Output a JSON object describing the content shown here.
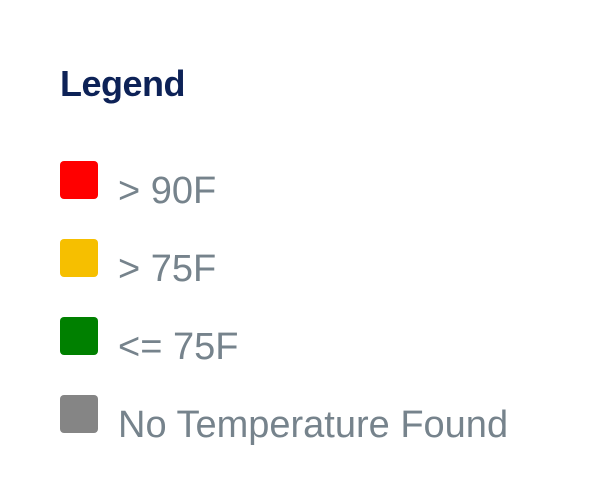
{
  "legend": {
    "title": "Legend",
    "items": [
      {
        "label": "> 90F",
        "color": "#ff0000"
      },
      {
        "label": "> 75F",
        "color": "#f6bf00"
      },
      {
        "label": "<= 75F",
        "color": "#008000"
      },
      {
        "label": "No Temperature Found",
        "color": "#858585"
      }
    ]
  }
}
